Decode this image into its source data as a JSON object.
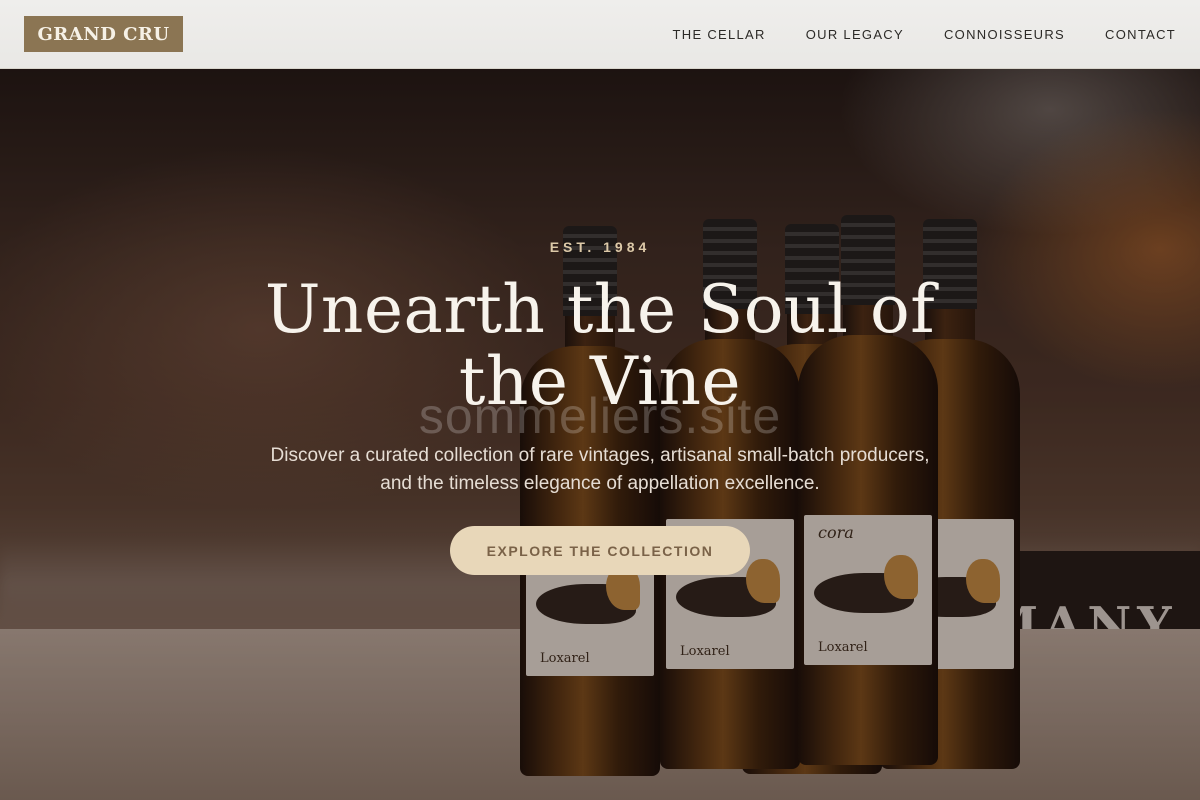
{
  "header": {
    "logo": "GRAND CRU",
    "nav": [
      {
        "label": "THE CELLAR"
      },
      {
        "label": "OUR LEGACY"
      },
      {
        "label": "CONNOISSEURS"
      },
      {
        "label": "CONTACT"
      }
    ]
  },
  "hero": {
    "eyebrow": "EST. 1984",
    "headline": "Unearth the Soul of the Vine",
    "subtext": "Discover a curated collection of rare vintages, artisanal small-batch producers, and the timeless elegance of appellation excellence.",
    "cta_label": "EXPLORE THE COLLECTION",
    "watermark": "sommeliers.site",
    "background_sign": "MANY",
    "bottle_label_name": "cora",
    "bottle_label_maker": "Loxarel"
  },
  "colors": {
    "logo_bg": "#8b7553",
    "header_bg": "#ecebe8",
    "cta_bg": "#e8d7b9",
    "cta_text": "#7a6248",
    "eyebrow": "#dcc9a8"
  }
}
